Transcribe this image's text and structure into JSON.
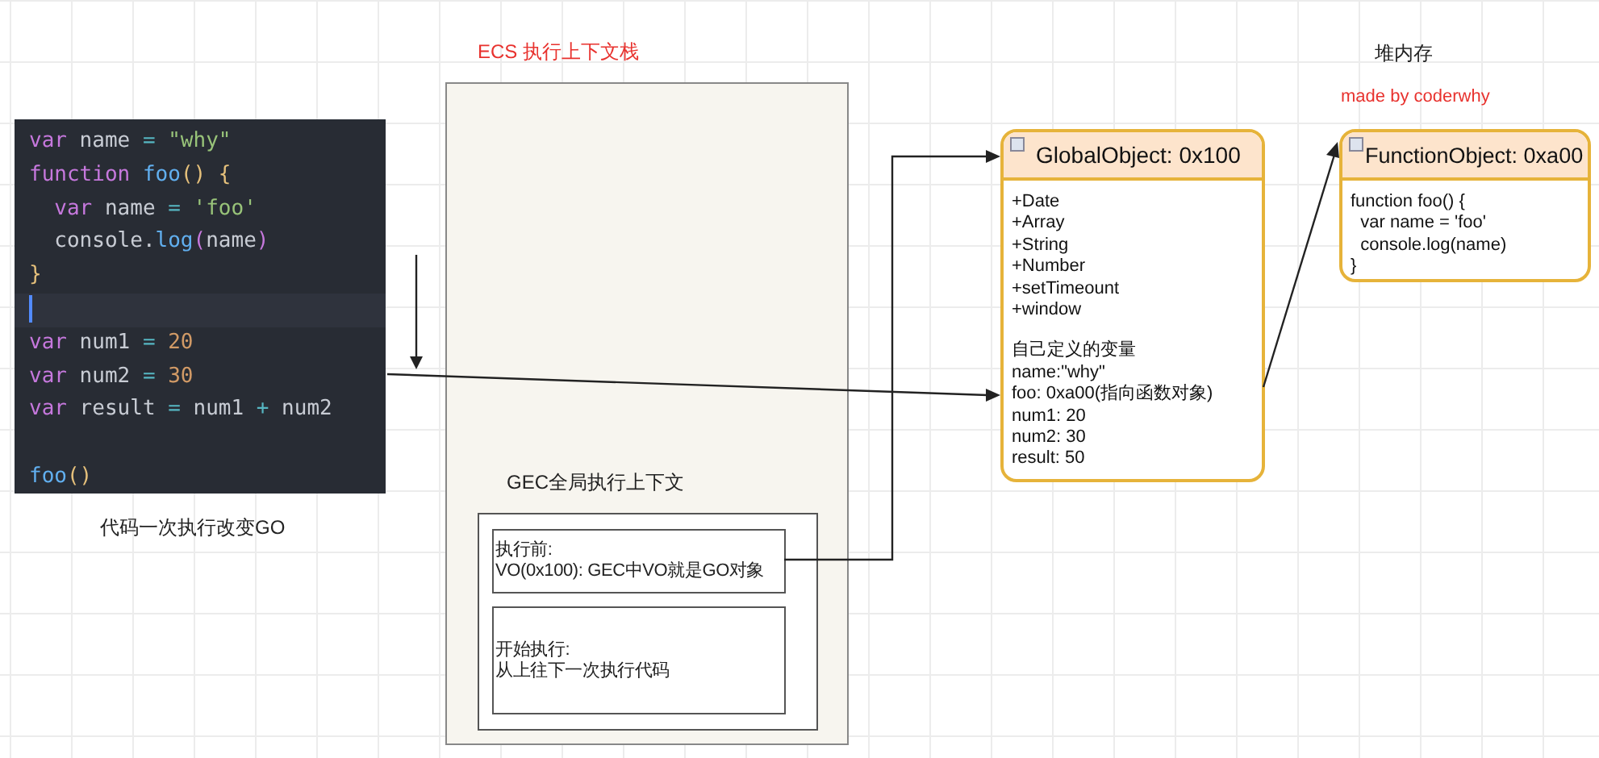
{
  "code_editor": {
    "lines": [
      {
        "kind": "code",
        "tokens": [
          {
            "text": "var",
            "kind": "keyword"
          },
          {
            "text": " name ",
            "kind": "plain"
          },
          {
            "text": "=",
            "kind": "operator"
          },
          {
            "text": " \"why\"",
            "kind": "string"
          }
        ]
      },
      {
        "kind": "code",
        "tokens": [
          {
            "text": "function",
            "kind": "keyword"
          },
          {
            "text": " foo",
            "kind": "function"
          },
          {
            "text": "()",
            "kind": "bracket"
          },
          {
            "text": " {",
            "kind": "bracket"
          }
        ]
      },
      {
        "kind": "code",
        "tokens": [
          {
            "text": "  var",
            "kind": "keyword"
          },
          {
            "text": " name ",
            "kind": "plain"
          },
          {
            "text": "=",
            "kind": "operator"
          },
          {
            "text": " 'foo'",
            "kind": "string"
          }
        ]
      },
      {
        "kind": "code",
        "tokens": [
          {
            "text": "  console.",
            "kind": "plain"
          },
          {
            "text": "log",
            "kind": "function"
          },
          {
            "text": "(",
            "kind": "paren"
          },
          {
            "text": "name",
            "kind": "plain"
          },
          {
            "text": ")",
            "kind": "paren"
          }
        ]
      },
      {
        "kind": "code",
        "tokens": [
          {
            "text": "}",
            "kind": "bracket"
          }
        ]
      },
      {
        "kind": "cursor"
      },
      {
        "kind": "code",
        "tokens": [
          {
            "text": "var",
            "kind": "keyword"
          },
          {
            "text": " num1 ",
            "kind": "plain"
          },
          {
            "text": "=",
            "kind": "operator"
          },
          {
            "text": " 20",
            "kind": "number"
          }
        ]
      },
      {
        "kind": "code",
        "tokens": [
          {
            "text": "var",
            "kind": "keyword"
          },
          {
            "text": " num2 ",
            "kind": "plain"
          },
          {
            "text": "=",
            "kind": "operator"
          },
          {
            "text": " 30",
            "kind": "number"
          }
        ]
      },
      {
        "kind": "code",
        "tokens": [
          {
            "text": "var",
            "kind": "keyword"
          },
          {
            "text": " result ",
            "kind": "plain"
          },
          {
            "text": "=",
            "kind": "operator"
          },
          {
            "text": " num1 ",
            "kind": "plain"
          },
          {
            "text": "+",
            "kind": "operator"
          },
          {
            "text": " num2",
            "kind": "plain"
          }
        ]
      },
      {
        "kind": "blank"
      },
      {
        "kind": "code",
        "tokens": [
          {
            "text": "foo",
            "kind": "function"
          },
          {
            "text": "()",
            "kind": "bracket"
          }
        ]
      }
    ]
  },
  "caption": "代码一次执行改变GO",
  "ecs": {
    "title": "ECS 执行上下文栈",
    "gec": {
      "title": "GEC全局执行上下文",
      "boxes": [
        {
          "lines": [
            "执行前:",
            "VO(0x100): GEC中VO就是GO对象"
          ]
        },
        {
          "lines": [
            "开始执行:",
            "从上往下一次执行代码"
          ]
        }
      ]
    }
  },
  "heap": {
    "title": "堆内存",
    "credit": "made by coderwhy",
    "objects": [
      {
        "title": "GlobalObject: 0x100",
        "groups": [
          [
            "+Date",
            "+Array",
            "+String",
            "+Number",
            "+setTimeount",
            "+window"
          ],
          [
            "自己定义的变量",
            "name:\"why\"",
            "foo: 0xa00(指向函数对象)",
            "num1: 20",
            "num2: 30",
            "result: 50"
          ]
        ]
      },
      {
        "title": "FunctionObject: 0xa00",
        "groups": [
          [
            "function foo() {",
            "  var name = 'foo'",
            "  console.log(name)",
            "}"
          ]
        ]
      }
    ]
  }
}
